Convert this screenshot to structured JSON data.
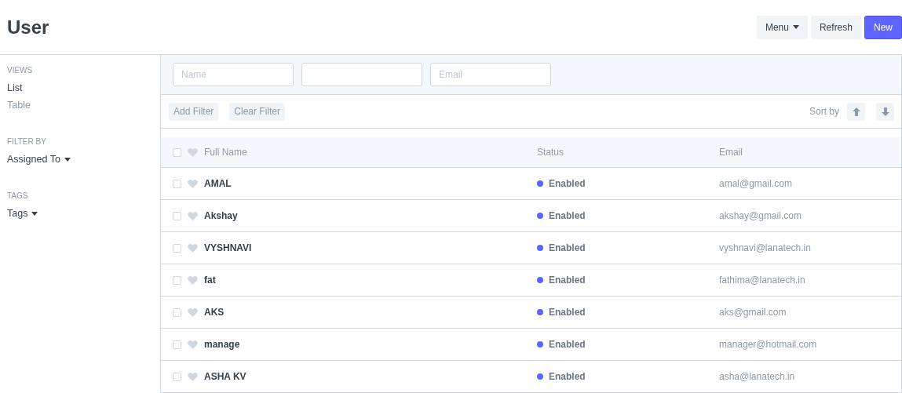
{
  "page_title": "User",
  "actions": [
    {
      "label": "Menu",
      "kind": "dropdown"
    },
    {
      "label": "Refresh",
      "kind": "default"
    },
    {
      "label": "New",
      "kind": "primary"
    }
  ],
  "sidebar": {
    "sections": [
      {
        "heading": "VIEWS",
        "items": [
          {
            "label": "List",
            "kind": "link",
            "selected": true
          },
          {
            "label": "Table",
            "kind": "link",
            "selected": false
          }
        ]
      },
      {
        "heading": "FILTER BY",
        "items": [
          {
            "label": "Assigned To",
            "kind": "dropdown"
          }
        ]
      },
      {
        "heading": "TAGS",
        "items": [
          {
            "label": "Tags",
            "kind": "dropdown"
          }
        ]
      }
    ]
  },
  "filters": [
    {
      "kind": "text",
      "placeholder": "Name"
    },
    {
      "kind": "blank"
    },
    {
      "kind": "text",
      "placeholder": "Email"
    }
  ],
  "filter_buttons": [
    "Add Filter",
    "Clear Filter"
  ],
  "sort": {
    "label": "Sort by"
  },
  "table": {
    "header_checked": false,
    "columns": [
      "Full Name",
      "Status",
      "Email"
    ],
    "rows": [
      {
        "name": "AMAL",
        "status": "Enabled",
        "email": "amal@gmail.com",
        "checked": false
      },
      {
        "name": "Akshay",
        "status": "Enabled",
        "email": "akshay@gmail.com",
        "checked": false
      },
      {
        "name": "VYSHNAVI",
        "status": "Enabled",
        "email": "vyshnavi@lanatech.in",
        "checked": false
      },
      {
        "name": "fat",
        "status": "Enabled",
        "email": "fathima@lanatech.in",
        "checked": false
      },
      {
        "name": "AKS",
        "status": "Enabled",
        "email": "aks@gmail.com",
        "checked": false
      },
      {
        "name": "manage",
        "status": "Enabled",
        "email": "manager@hotmail.com",
        "checked": false
      },
      {
        "name": "ASHA KV",
        "status": "Enabled",
        "email": "asha@lanatech.in",
        "checked": false
      }
    ]
  }
}
